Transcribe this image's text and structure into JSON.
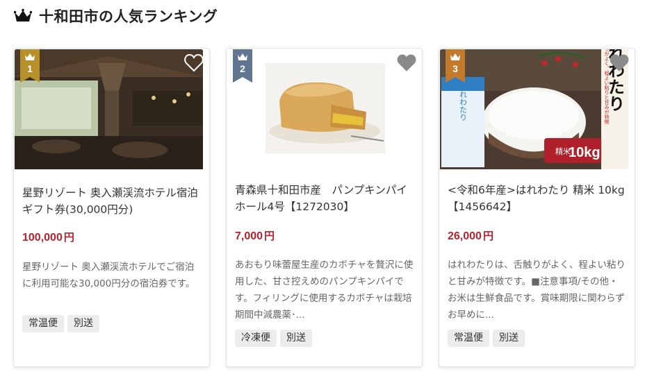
{
  "heading": {
    "title": "十和田市の人気ランキング",
    "icon": "crown-icon"
  },
  "colors": {
    "gold": "#b8902a",
    "silver": "#5f7590",
    "bronze": "#c47a2c",
    "price": "#b8202b"
  },
  "products": [
    {
      "rank": "1",
      "name": "星野リゾート 奥入瀬渓流ホテル宿泊ギフト券(30,000円分)",
      "price": "100,000",
      "price_unit": "円",
      "description": "星野リゾート 奥入瀬渓流ホテルでご宿泊に利用可能な30,000円分の宿泊券です。",
      "tags": [
        "常温便",
        "別送"
      ]
    },
    {
      "rank": "2",
      "name": "青森県十和田市産　パンプキンパイホール4号【1272030】",
      "price": "7,000",
      "price_unit": "円",
      "description": "あおもり味蕾屋生産のカボチャを贅沢に使用した、甘さ控えめのパンプキンパイです。フィリングに使用するカボチャは栽培期間中減農薬･...",
      "tags": [
        "冷凍便",
        "別送"
      ]
    },
    {
      "rank": "3",
      "name": "<令和6年産>はれわたり 精米 10kg【1456642】",
      "price": "26,000",
      "price_unit": "円",
      "description": "はれわたりは、舌触りがよく、程よい粘りと甘みが特徴です。■注意事項/その他・お米は生鮮食品です。賞味期限に関わらずお早めに...",
      "tags": [
        "常温便",
        "別送"
      ],
      "image_text": {
        "brand": "はれわたり",
        "kind": "精米",
        "weight": "10kg",
        "catch": "舌触りがよく、程よい粘りと甘みが特徴",
        "bag": "はれわたり"
      }
    }
  ]
}
